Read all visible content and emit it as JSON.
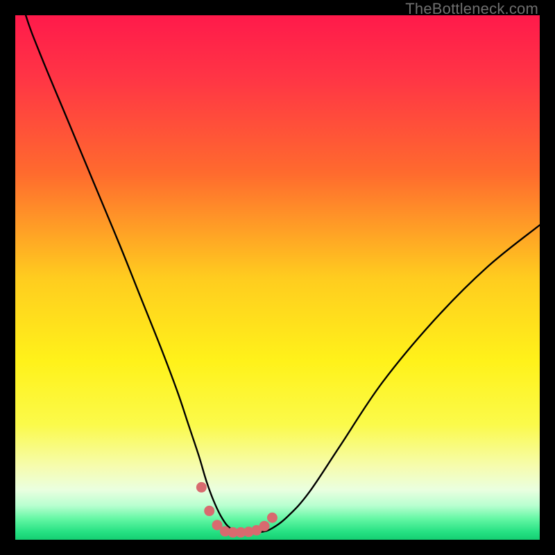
{
  "watermark": {
    "text": "TheBottleneck.com"
  },
  "colors": {
    "bg_black": "#000000",
    "curve": "#000000",
    "dot_fill": "#d86a6f",
    "gradient_stops": [
      {
        "offset": 0.0,
        "color": "#ff1a4b"
      },
      {
        "offset": 0.12,
        "color": "#ff3545"
      },
      {
        "offset": 0.3,
        "color": "#ff6a2e"
      },
      {
        "offset": 0.5,
        "color": "#ffcc1f"
      },
      {
        "offset": 0.66,
        "color": "#fff21a"
      },
      {
        "offset": 0.78,
        "color": "#fbfa4a"
      },
      {
        "offset": 0.86,
        "color": "#f6fcae"
      },
      {
        "offset": 0.905,
        "color": "#eaffe0"
      },
      {
        "offset": 0.935,
        "color": "#b8ffd0"
      },
      {
        "offset": 0.96,
        "color": "#64f7a4"
      },
      {
        "offset": 0.985,
        "color": "#26e183"
      },
      {
        "offset": 1.0,
        "color": "#15cf73"
      }
    ]
  },
  "chart_data": {
    "type": "line",
    "title": "",
    "xlabel": "",
    "ylabel": "",
    "xlim": [
      0,
      100
    ],
    "ylim": [
      0,
      100
    ],
    "grid": false,
    "legend": false,
    "x": [
      0,
      2,
      5,
      10,
      15,
      20,
      24,
      28,
      31,
      33,
      35,
      36.5,
      38,
      39.5,
      41,
      43,
      45,
      47,
      49,
      52,
      56,
      62,
      70,
      80,
      90,
      100
    ],
    "series": [
      {
        "name": "bottleneck-curve",
        "values": [
          108,
          100,
          92,
          80,
          68,
          56,
          46,
          36,
          28,
          22,
          16,
          11,
          7,
          4,
          2.2,
          1.5,
          1.4,
          1.5,
          2.2,
          4.5,
          9,
          18,
          30,
          42,
          52,
          60
        ]
      }
    ],
    "markers": {
      "name": "bottom-dots",
      "x": [
        35.5,
        37.0,
        38.5,
        40.0,
        41.5,
        43.0,
        44.5,
        46.0,
        47.5,
        49.0
      ],
      "y": [
        10.0,
        5.5,
        2.8,
        1.6,
        1.4,
        1.4,
        1.5,
        1.8,
        2.6,
        4.2
      ]
    }
  }
}
